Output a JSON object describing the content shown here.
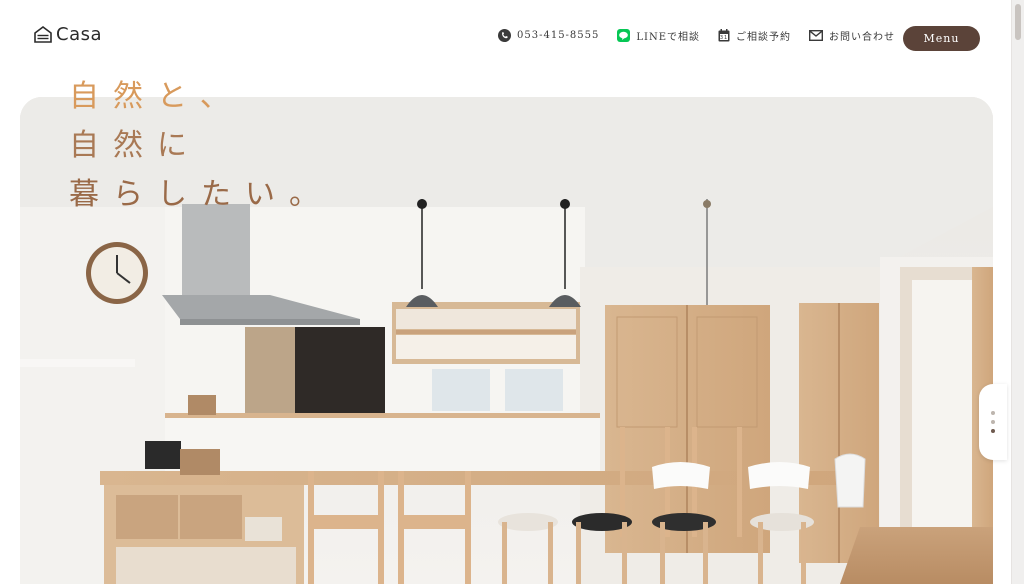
{
  "header": {
    "logo_text": "Casa",
    "phone": "053-415-8555",
    "line_label": "LINEで相談",
    "reserve_label": "ご相談予約",
    "contact_label": "お問い合わせ",
    "menu_label": "Menu"
  },
  "hero": {
    "catch_lines": [
      "自然と、",
      "自然に",
      "暮らしたい。"
    ]
  },
  "colors": {
    "menu_button": "#5b4339",
    "line_green": "#06c755",
    "catch_orange": "#d89a5c",
    "catch_brown": "#9a6a48"
  },
  "icons": [
    "house-logo-icon",
    "phone-icon",
    "line-icon",
    "calendar-icon",
    "mail-icon"
  ]
}
